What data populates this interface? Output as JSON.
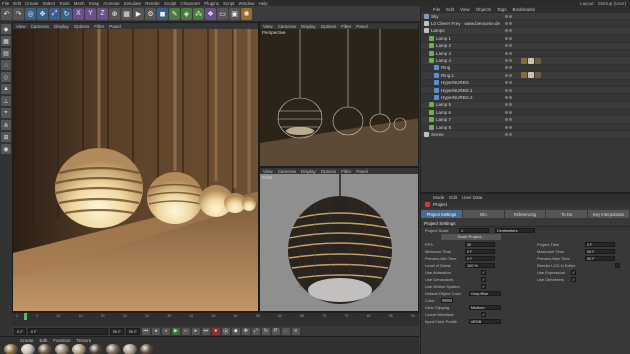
{
  "menubar": {
    "items": [
      "File",
      "Edit",
      "Create",
      "Select",
      "Tools",
      "Mesh",
      "Snap",
      "Animate",
      "Simulate",
      "Render",
      "Sculpt",
      "Character",
      "Plugins",
      "Script",
      "Window",
      "Help"
    ],
    "layout_label": "Layout:",
    "layout_value": "Startup (User)"
  },
  "toolbar": {
    "buttons": [
      "undo-icon",
      "redo-icon",
      "live-select-icon",
      "move-icon",
      "scale-icon",
      "rotate-icon",
      "x-axis-icon",
      "y-axis-icon",
      "z-axis-icon",
      "coordinate-icon",
      "render-view-icon",
      "render-picture-icon",
      "render-settings-icon",
      "cube-icon",
      "pen-icon",
      "subdivision-icon",
      "array-icon",
      "deformer-icon",
      "floor-icon",
      "camera-icon",
      "light-icon"
    ]
  },
  "viewport_menu": [
    "View",
    "Cameras",
    "Display",
    "Options",
    "Filter",
    "Panel"
  ],
  "viewports": {
    "perspective_title": "Perspective",
    "front_title": "Front"
  },
  "timeline": {
    "ticks": [
      "0",
      "5",
      "10",
      "15",
      "20",
      "25",
      "30",
      "35",
      "40",
      "45",
      "50",
      "55",
      "60",
      "65",
      "70",
      "75",
      "80",
      "85",
      "90"
    ],
    "start": "0 F",
    "current": "0 F",
    "end": "90 F",
    "end2": "90 F"
  },
  "material_manager": {
    "menu": [
      "Create",
      "Edit",
      "Function",
      "Texture"
    ],
    "swatches": [
      "#8a6a3a",
      "#c9c2b5",
      "#6d5a3f",
      "#9a8a70",
      "#b5a27e",
      "#4d4436",
      "#7c6e58",
      "#a89c84",
      "#5a4a36"
    ]
  },
  "object_manager": {
    "menu": [
      "File",
      "Edit",
      "View",
      "Objects",
      "Tags",
      "Bookmarks"
    ],
    "rows": [
      {
        "label": "Sky",
        "indent": 0,
        "color": "#7a9ac0"
      },
      {
        "label": "L0 Clever Frey · www.bensome.de",
        "indent": 0,
        "color": "#c0c0c0"
      },
      {
        "label": "Lamps",
        "indent": 0,
        "color": "#c0c0c0"
      },
      {
        "label": "Lamp 1",
        "indent": 1,
        "color": "#6ab04c"
      },
      {
        "label": "Lamp 2",
        "indent": 1,
        "color": "#6ab04c"
      },
      {
        "label": "Lamp 3",
        "indent": 1,
        "color": "#6ab04c"
      },
      {
        "label": "Lamp 4",
        "indent": 1,
        "color": "#6ab04c"
      },
      {
        "label": "Ring",
        "indent": 2,
        "color": "#5a8fd0"
      },
      {
        "label": "Ring.1",
        "indent": 2,
        "color": "#5a8fd0"
      },
      {
        "label": "HyperNURBS",
        "indent": 2,
        "color": "#5a8fd0"
      },
      {
        "label": "HyperNURBS.1",
        "indent": 2,
        "color": "#5a8fd0"
      },
      {
        "label": "HyperNURBS.2",
        "indent": 2,
        "color": "#5a8fd0"
      },
      {
        "label": "Lamp 5",
        "indent": 1,
        "color": "#6ab04c"
      },
      {
        "label": "Lamp 6",
        "indent": 1,
        "color": "#6ab04c"
      },
      {
        "label": "Lamp 7",
        "indent": 1,
        "color": "#6ab04c"
      },
      {
        "label": "Lamp 8",
        "indent": 1,
        "color": "#6ab04c"
      },
      {
        "label": "Scene",
        "indent": 0,
        "color": "#c0c0c0"
      }
    ]
  },
  "attribute_manager": {
    "menu": [
      "Mode",
      "Edit",
      "User Data"
    ],
    "title": "Project",
    "tabs": [
      "Project Settings",
      "Info",
      "Referencing",
      "To Do",
      "Key Interpolation"
    ],
    "section": "Project Settings",
    "project_scale_label": "Project Scale",
    "project_scale_value": "1",
    "project_scale_unit": "Centimeters",
    "scale_button": "Scale Project...",
    "fps_label": "FPS",
    "fps_value": "30",
    "project_time_label": "Project Time",
    "project_time_value": "0 F",
    "min_time_label": "Minimum Time",
    "min_time_value": "0 F",
    "max_time_label": "Maximum Time",
    "max_time_value": "90 F",
    "preview_min_label": "Preview Min Time",
    "preview_min_value": "0 F",
    "preview_max_label": "Preview Max Time",
    "preview_max_value": "90 F",
    "lod_label": "Level of Detail",
    "lod_value": "100 %",
    "render_lod_label": "Render LOD in Editor",
    "use_animation_label": "Use Animation",
    "use_expression_label": "Use Expression",
    "use_generators_label": "Use Generators",
    "use_deformers_label": "Use Deformers",
    "use_motion_label": "Use Motion System",
    "default_color_label": "Default Object Color",
    "default_color_value": "Gray-Blue",
    "color_label": "Color",
    "view_clipping_label": "View Clipping",
    "view_clipping_value": "Medium",
    "linear_workflow_label": "Linear Workflow",
    "input_color_label": "Input Color Profile",
    "input_color_value": "sRGB"
  }
}
